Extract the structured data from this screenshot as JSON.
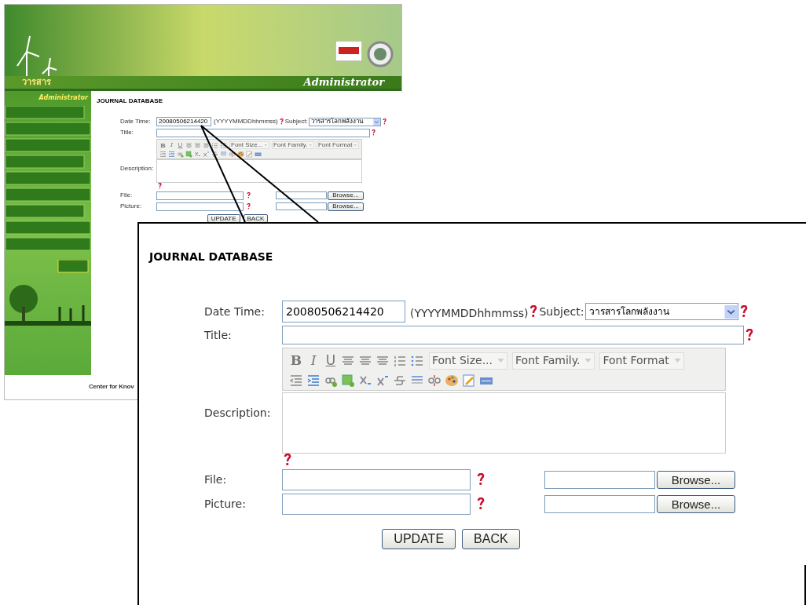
{
  "thumbnail": {
    "header": {
      "section_title": "วารสาร",
      "role": "Administrator"
    },
    "sidebar": {
      "heading": "Administrator"
    },
    "form": {
      "title": "JOURNAL DATABASE",
      "date_label": "Date Time:",
      "date_value": "20080506214420",
      "date_hint": "(YYYYMMDDhhmmss)",
      "date_required": true,
      "subject_label": "Subject:",
      "subject_value": "วารสารโลกพลังงาน",
      "subject_required": true,
      "title_label": "Title:",
      "title_required": true,
      "toolbar": {
        "format_buttons": [
          "B",
          "I",
          "U"
        ],
        "dropdowns": [
          "Font Size...",
          "Font Family.",
          "Font Format"
        ]
      },
      "description_label": "Description:",
      "description_required": true,
      "uploads": [
        {
          "label": "File:",
          "required": true,
          "button": "Browse..."
        },
        {
          "label": "Picture:",
          "required": true,
          "button": "Browse..."
        }
      ],
      "buttons": [
        "UPDATE",
        "BACK"
      ]
    },
    "footer": "Center for Knov"
  },
  "zoomed": {
    "form": {
      "title": "JOURNAL DATABASE",
      "date_label": "Date Time:",
      "date_value": "20080506214420",
      "date_hint": "(YYYYMMDDhhmmss)",
      "date_required": true,
      "subject_label": "Subject:",
      "subject_value": "วารสารโลกพลังงาน",
      "subject_required": true,
      "title_label": "Title:",
      "title_required": true,
      "toolbar": {
        "format_buttons": [
          "B",
          "I",
          "U"
        ],
        "dropdowns": [
          "Font Size...",
          "Font Family.",
          "Font Format"
        ]
      },
      "description_label": "Description:",
      "description_required": true,
      "uploads": [
        {
          "label": "File:",
          "required": true,
          "button": "Browse..."
        },
        {
          "label": "Picture:",
          "required": true,
          "button": "Browse..."
        }
      ],
      "buttons": [
        "UPDATE",
        "BACK"
      ]
    }
  }
}
